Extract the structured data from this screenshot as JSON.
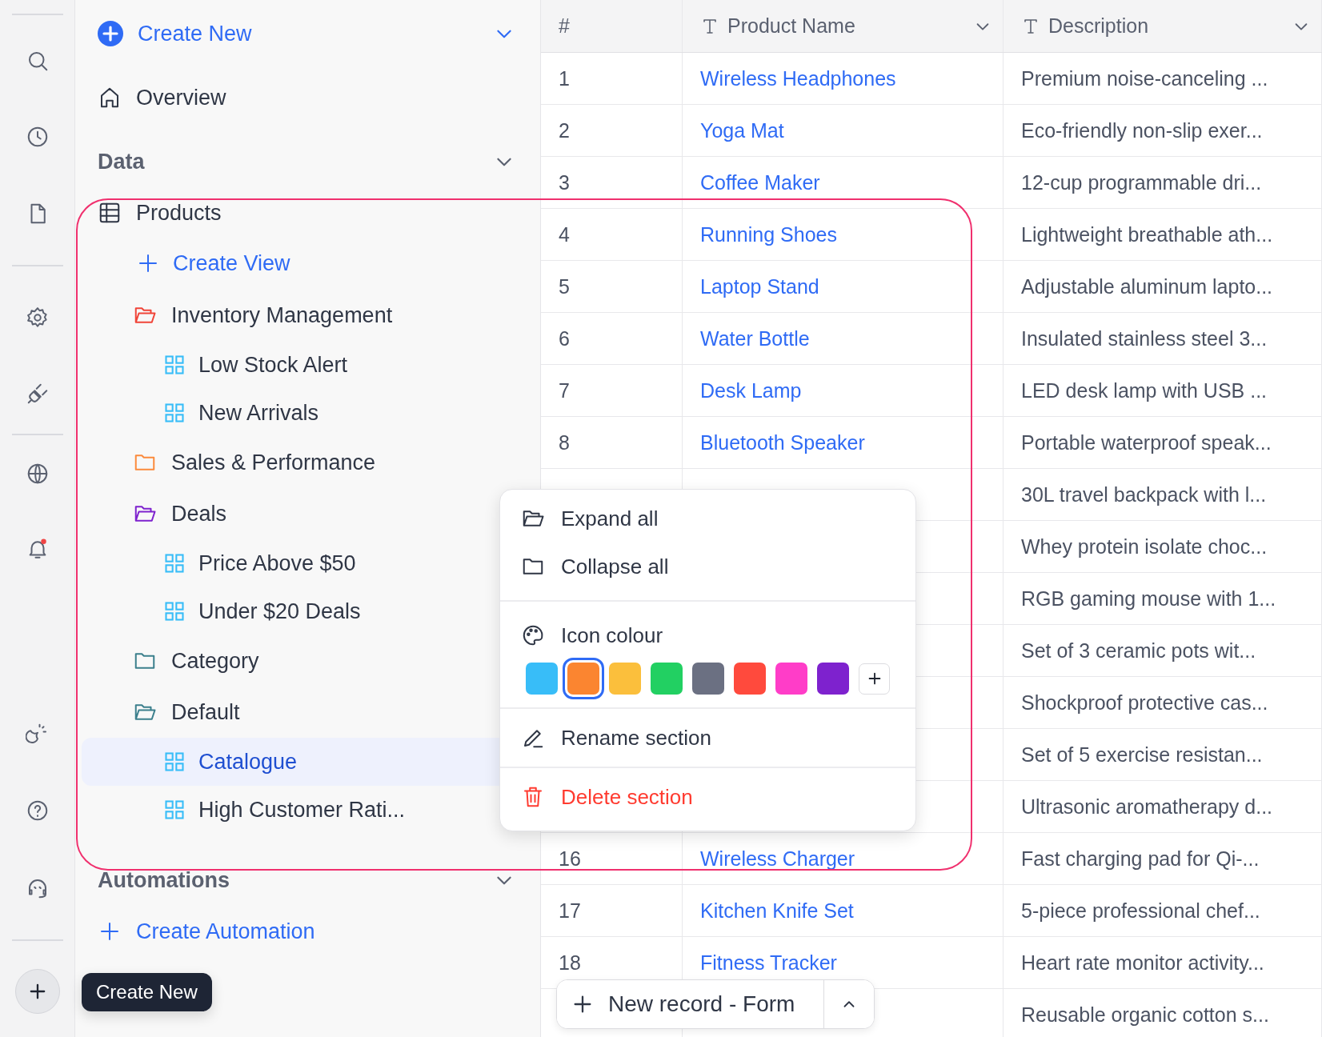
{
  "sidebar": {
    "create_new": "Create New",
    "overview": "Overview",
    "data_section": {
      "title": "Data",
      "table": {
        "label": "Products",
        "create_view": "Create View",
        "folders": [
          {
            "label": "Inventory Management",
            "color": "#f04438",
            "expanded": true,
            "views": [
              {
                "label": "Low Stock Alert",
                "selected": false
              },
              {
                "label": "New Arrivals",
                "selected": false
              }
            ]
          },
          {
            "label": "Sales & Performance",
            "color": "#fb8a3c",
            "expanded": false
          },
          {
            "label": "Deals",
            "color": "#7e22ce",
            "expanded": true,
            "views": [
              {
                "label": "Price Above $50",
                "selected": false
              },
              {
                "label": "Under $20 Deals",
                "selected": false
              }
            ]
          },
          {
            "label": "Category",
            "color": "#3b7f8c",
            "expanded": false
          },
          {
            "label": "Default",
            "color": "#3b7f8c",
            "expanded": true,
            "views": [
              {
                "label": "Catalogue",
                "selected": true
              },
              {
                "label": "High Customer Rati...",
                "selected": false
              }
            ]
          }
        ]
      }
    },
    "automations_section": {
      "title": "Automations",
      "create": "Create Automation"
    }
  },
  "tooltip": "Create New",
  "table": {
    "columns": [
      {
        "label": "#",
        "kind": "index"
      },
      {
        "label": "Product Name",
        "kind": "text"
      },
      {
        "label": "Description",
        "kind": "text"
      }
    ],
    "rows": [
      {
        "num": "1",
        "name": "Wireless Headphones",
        "description": "Premium noise-canceling ..."
      },
      {
        "num": "2",
        "name": "Yoga Mat",
        "description": "Eco-friendly non-slip exer..."
      },
      {
        "num": "3",
        "name": "Coffee Maker",
        "description": "12-cup programmable dri..."
      },
      {
        "num": "4",
        "name": "Running Shoes",
        "description": "Lightweight breathable ath..."
      },
      {
        "num": "5",
        "name": "Laptop Stand",
        "description": "Adjustable aluminum lapto..."
      },
      {
        "num": "6",
        "name": "Water Bottle",
        "description": "Insulated stainless steel 3..."
      },
      {
        "num": "7",
        "name": "Desk Lamp",
        "description": "LED desk lamp with USB ..."
      },
      {
        "num": "8",
        "name": "Bluetooth Speaker",
        "description": "Portable waterproof speak..."
      },
      {
        "description": "30L travel backpack with l..."
      },
      {
        "description": "Whey protein isolate choc..."
      },
      {
        "description": "RGB gaming mouse with 1..."
      },
      {
        "description": "Set of 3 ceramic pots wit..."
      },
      {
        "description": "Shockproof protective cas..."
      },
      {
        "description": "Set of 5 exercise resistan..."
      },
      {
        "description": "Ultrasonic aromatherapy d..."
      },
      {
        "num": "16",
        "name": "Wireless Charger",
        "description": "Fast charging pad for Qi-..."
      },
      {
        "num": "17",
        "name": "Kitchen Knife Set",
        "description": "5-piece professional chef..."
      },
      {
        "num": "18",
        "name": "Fitness Tracker",
        "description": "Heart rate monitor activity..."
      },
      {
        "description": "Reusable organic cotton s..."
      }
    ]
  },
  "new_record": {
    "label": "New record - Form"
  },
  "context_menu": {
    "items": [
      {
        "kind": "expand",
        "label": "Expand all"
      },
      {
        "kind": "collapse",
        "label": "Collapse all"
      },
      {
        "kind": "colour",
        "label": "Icon colour",
        "swatches": [
          {
            "color": "#38bdf8",
            "selected": false
          },
          {
            "color": "#fb8530",
            "selected": true
          },
          {
            "color": "#fbbf3c",
            "selected": false
          },
          {
            "color": "#22d062",
            "selected": false
          },
          {
            "color": "#6b7082",
            "selected": false
          },
          {
            "color": "#ff4a3d",
            "selected": false
          },
          {
            "color": "#ff3dc8",
            "selected": false
          },
          {
            "color": "#7e22ce",
            "selected": false
          }
        ]
      },
      {
        "kind": "rename",
        "label": "Rename section"
      },
      {
        "kind": "delete",
        "label": "Delete section"
      }
    ]
  }
}
